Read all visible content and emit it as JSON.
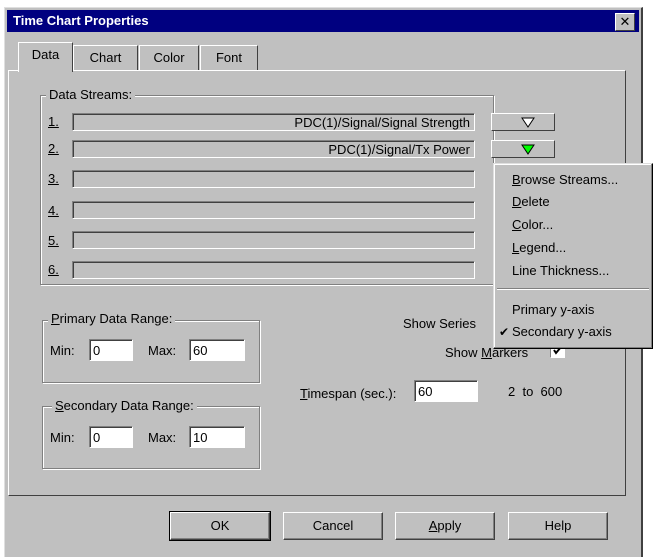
{
  "window": {
    "title": "Time Chart Properties",
    "close_glyph": "✕"
  },
  "tabs": [
    {
      "label": "Data",
      "active": true
    },
    {
      "label": "Chart",
      "active": false
    },
    {
      "label": "Color",
      "active": false
    },
    {
      "label": "Font",
      "active": false
    }
  ],
  "data_streams": {
    "label": "Data Streams:",
    "items": [
      {
        "num": "1.",
        "value": "PDC(1)/Signal/Signal Strength",
        "has_button": true,
        "arrow_color": "#ffffff"
      },
      {
        "num": "2.",
        "value": "PDC(1)/Signal/Tx Power",
        "has_button": true,
        "arrow_color": "#00ff00"
      },
      {
        "num": "3.",
        "value": ""
      },
      {
        "num": "4.",
        "value": ""
      },
      {
        "num": "5.",
        "value": ""
      },
      {
        "num": "6.",
        "value": ""
      }
    ]
  },
  "primary_range": {
    "label_u": "P",
    "label_rest": "rimary Data Range:",
    "min_label": "Min:",
    "min": "0",
    "max_label": "Max:",
    "max": "60"
  },
  "secondary_range": {
    "label_u": "S",
    "label_rest": "econdary Data Range:",
    "min_label": "Min:",
    "min": "0",
    "max_label": "Max:",
    "max": "10"
  },
  "show_series": {
    "label": "Show Series"
  },
  "show_markers": {
    "label_pre": "Show ",
    "label_u": "M",
    "label_rest": "arkers",
    "checked": true
  },
  "timespan": {
    "label_u": "T",
    "label_rest": "imespan (sec.):",
    "value": "60",
    "range_text": "2  to  600"
  },
  "buttons": {
    "ok": "OK",
    "cancel": "Cancel",
    "apply_u": "A",
    "apply_rest": "pply",
    "help": "Help"
  },
  "context_menu": {
    "items": [
      {
        "u": "B",
        "rest": "rowse Streams..."
      },
      {
        "u": "D",
        "rest": "elete"
      },
      {
        "u": "C",
        "rest": "olor..."
      },
      {
        "u": "L",
        "rest": "egend..."
      },
      {
        "u": "",
        "rest": "Line Thickness..."
      }
    ],
    "axis_items": [
      {
        "label": "Primary y-axis",
        "checked": false
      },
      {
        "label": "Secondary y-axis",
        "checked": true
      }
    ],
    "check_glyph": "✔"
  }
}
